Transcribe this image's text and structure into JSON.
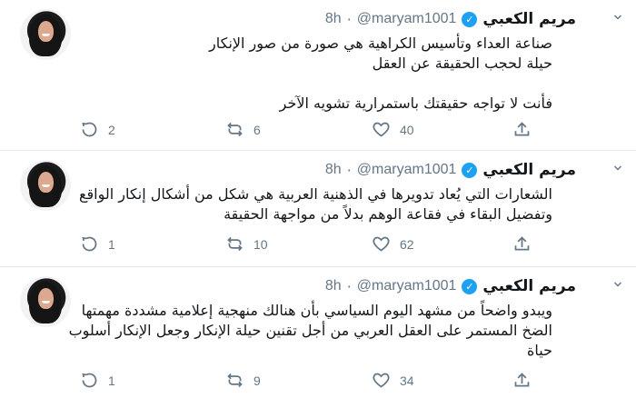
{
  "tweets": [
    {
      "author": {
        "name": "مريم الكعبي",
        "handle": "@maryam1001",
        "time": "8h"
      },
      "text_lines": [
        "صناعة العداء وتأسيس الكراهية هي صورة من صور الإنكار",
        "حيلة لحجب الحقيقة عن العقل",
        "",
        "فأنت لا تواجه حقيقتك باستمرارية تشويه الآخر"
      ],
      "replies": "2",
      "retweets": "6",
      "likes": "40"
    },
    {
      "author": {
        "name": "مريم الكعبي",
        "handle": "@maryam1001",
        "time": "8h"
      },
      "text_lines": [
        "الشعارات التي يُعاد تدويرها في الذهنية العربية هي شكل من أشكال إنكار الواقع",
        "وتفضيل البقاء في فقاعة الوهم بدلاً من مواجهة الحقيقة"
      ],
      "replies": "1",
      "retweets": "10",
      "likes": "62"
    },
    {
      "author": {
        "name": "مريم الكعبي",
        "handle": "@maryam1001",
        "time": "8h"
      },
      "text_lines": [
        "ويبدو واضحاً من مشهد اليوم السياسي بأن هنالك منهجية إعلامية مشددة مهمتها",
        "الضخ المستمر على العقل العربي من أجل تقنين حيلة الإنكار وجعل الإنكار أسلوب",
        "حياة"
      ],
      "replies": "1",
      "retweets": "9",
      "likes": "34"
    }
  ],
  "icons": {
    "verified": "verified-badge-icon",
    "caret": "chevron-down-icon",
    "reply": "reply-icon",
    "retweet": "retweet-icon",
    "like": "heart-icon",
    "share": "share-icon"
  },
  "colors": {
    "accent": "#1da1f2",
    "muted": "#657786",
    "text": "#14171a",
    "divider": "#e6ecf0"
  }
}
